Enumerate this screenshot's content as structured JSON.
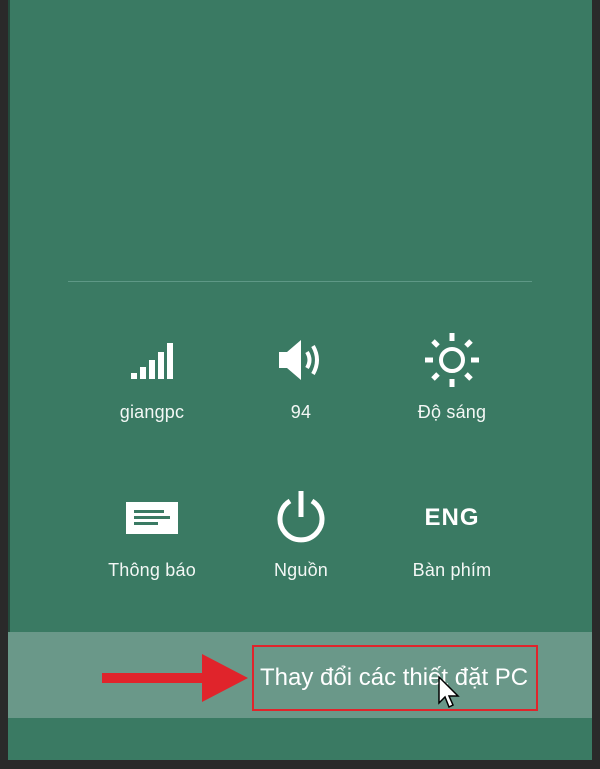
{
  "colors": {
    "panel_bg": "#3a7a63",
    "settings_bar_bg": "#6a9889",
    "highlight_red": "#e0242b",
    "text": "#ffffff"
  },
  "quick_settings": [
    {
      "icon": "network-signal-icon",
      "label": "giangpc"
    },
    {
      "icon": "volume-icon",
      "label": "94"
    },
    {
      "icon": "brightness-icon",
      "label": "Độ sáng"
    },
    {
      "icon": "notifications-icon",
      "label": "Thông báo"
    },
    {
      "icon": "power-icon",
      "label": "Nguồn"
    },
    {
      "icon_text": "ENG",
      "label": "Bàn phím"
    }
  ],
  "settings_link": {
    "label": "Thay đổi các thiết đặt PC"
  }
}
